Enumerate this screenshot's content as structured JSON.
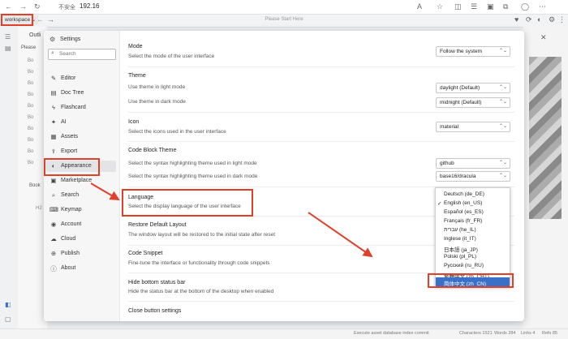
{
  "browser": {
    "security_label": "不安全",
    "url": "192.16",
    "workspace_label": "workspace",
    "center_text": "Please Start Here"
  },
  "outline": {
    "title": "Outli",
    "rows": [
      "Please",
      "Bo",
      "Bo",
      "Bo",
      "Bo",
      "Bo",
      "Bo",
      "Bo",
      "Bo",
      "Bo",
      "Bo"
    ],
    "bookmarks": "Book",
    "heading": "H2"
  },
  "settings": {
    "title": "Settings",
    "search_placeholder": "Search",
    "nav": [
      {
        "label": "Editor",
        "icon": "✎"
      },
      {
        "label": "Doc Tree",
        "icon": "▤"
      },
      {
        "label": "Flashcard",
        "icon": "ϟ"
      },
      {
        "label": "AI",
        "icon": "✦"
      },
      {
        "label": "Assets",
        "icon": "▦"
      },
      {
        "label": "Export",
        "icon": "⇪"
      },
      {
        "label": "Appearance",
        "icon": "◐"
      },
      {
        "label": "Marketplace",
        "icon": "▣"
      },
      {
        "label": "Search",
        "icon": "⌕"
      },
      {
        "label": "Keymap",
        "icon": "⌨"
      },
      {
        "label": "Account",
        "icon": "◉"
      },
      {
        "label": "Cloud",
        "icon": "☁"
      },
      {
        "label": "Publish",
        "icon": "⊕"
      },
      {
        "label": "About",
        "icon": "ⓘ"
      }
    ],
    "active_nav": "Appearance",
    "sections": {
      "mode": {
        "title": "Mode",
        "desc": "Select the mode of the user interface",
        "value": "Follow the system"
      },
      "theme": {
        "title": "Theme",
        "light_desc": "Use theme in light mode",
        "light_value": "daylight (Default)",
        "dark_desc": "Use theme in dark mode",
        "dark_value": "midnight (Default)"
      },
      "icon": {
        "title": "Icon",
        "desc": "Select the icons used in the user interface",
        "value": "material"
      },
      "code_block": {
        "title": "Code Block Theme",
        "light_desc": "Select the syntax highlighting theme used in light mode",
        "light_value": "github",
        "dark_desc": "Select the syntax highlighting theme used in dark mode",
        "dark_value": "base16/dracula"
      },
      "language": {
        "title": "Language",
        "desc": "Select the display language of the user interface"
      },
      "restore": {
        "title": "Restore Default Layout",
        "desc": "The window layout will be restored to the initial state after reset"
      },
      "snippet": {
        "title": "Code Snippet",
        "desc": "Fine-tune the interface or functionality through code snippets"
      },
      "statusbar": {
        "title": "Hide bottom status bar",
        "desc": "Hide the status bar at the bottom of the desktop when enabled"
      },
      "close": {
        "title": "Close button settings"
      }
    },
    "languages": [
      "Deutsch (de_DE)",
      "English (en_US)",
      "Español (es_ES)",
      "Français (fr_FR)",
      "עברית (he_IL)",
      "Inglese (it_IT)",
      "日本語 (ja_JP)",
      "Polski (pl_PL)",
      "Русский (ru_RU)",
      "繁體中文 (zh_CHT)",
      "简体中文 (zh_CN)"
    ],
    "checked_language": "English (en_US)",
    "highlighted_language": "简体中文 (zh_CN)"
  },
  "statusbar": {
    "message": "Execute asset database index commit",
    "characters": "Characters 1521",
    "words": "Words 284",
    "links": "Links 4",
    "refs": "Refs 85"
  },
  "colors": {
    "annotation": "#e0402a",
    "highlight": "#3b70c8"
  }
}
